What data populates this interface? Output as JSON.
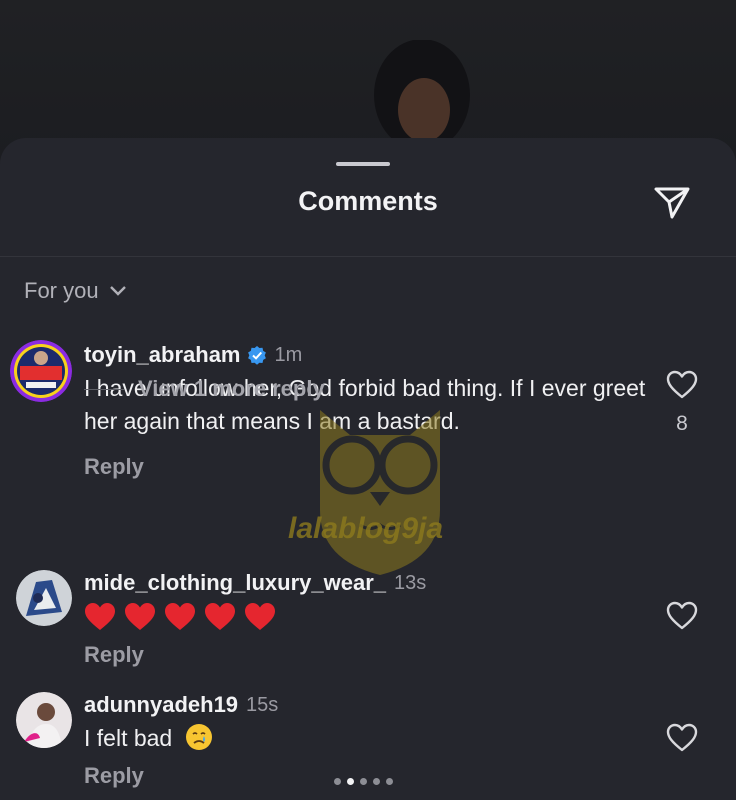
{
  "sheet": {
    "title": "Comments",
    "filter_label": "For you"
  },
  "comments": [
    {
      "username": "toyin_abraham",
      "verified": true,
      "time": "1m",
      "text": "I have unfollow her, God forbid bad thing. If I ever greet her again that means I am a bastard.",
      "reply_label": "Reply",
      "likes": "8",
      "view_more": "View 1 more reply"
    },
    {
      "username": "mide_clothing_luxury_wear_",
      "time": "13s",
      "emoji_text": "❤️❤️❤️❤️❤️",
      "reply_label": "Reply"
    },
    {
      "username": "adunnyadeh19",
      "time": "15s",
      "text": "I felt bad",
      "reply_label": "Reply"
    }
  ],
  "watermark": {
    "text": "lalablog9ja"
  },
  "pager": {
    "count": 5,
    "active_index": 1
  },
  "colors": {
    "sheet_bg": "#25262d",
    "verified_blue": "#3897f0",
    "heart_red": "#e5262f",
    "watermark_gold": "#8d7a1d"
  }
}
